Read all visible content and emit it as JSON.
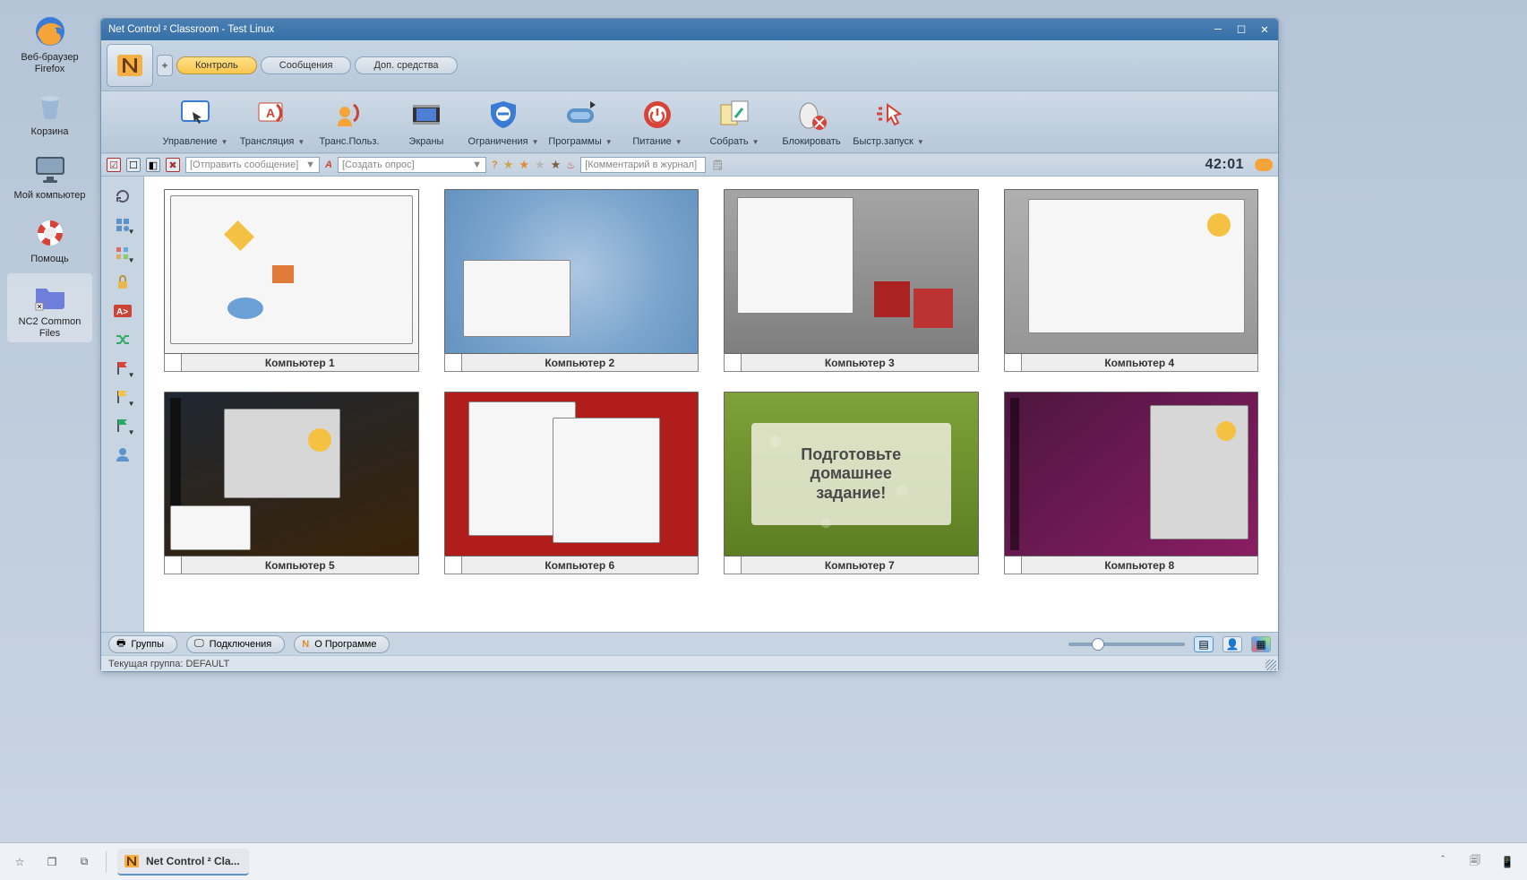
{
  "desktop": {
    "icons": [
      {
        "name": "firefox",
        "label": "Веб-браузер\nFirefox"
      },
      {
        "name": "trash",
        "label": "Корзина"
      },
      {
        "name": "mycomputer",
        "label": "Мой компьютер"
      },
      {
        "name": "help",
        "label": "Помощь"
      },
      {
        "name": "nc2files",
        "label": "NC2 Common\nFiles"
      }
    ]
  },
  "window": {
    "title": "Net Control ² Classroom - Test Linux",
    "ribbon_tabs": [
      "Контроль",
      "Сообщения",
      "Доп. средства"
    ],
    "active_tab": 0,
    "tools": [
      {
        "label": "Управление",
        "drop": true
      },
      {
        "label": "Трансляция",
        "drop": true
      },
      {
        "label": "Транс.Польз.",
        "drop": false
      },
      {
        "label": "Экраны",
        "drop": false
      },
      {
        "label": "Ограничения",
        "drop": true
      },
      {
        "label": "Программы",
        "drop": true
      },
      {
        "label": "Питание",
        "drop": true
      },
      {
        "label": "Собрать",
        "drop": true
      },
      {
        "label": "Блокировать",
        "drop": false
      },
      {
        "label": "Быстр.запуск",
        "drop": true
      }
    ],
    "send_msg_placeholder": "[Отправить сообщение]",
    "create_poll_placeholder": "[Создать опрос]",
    "journal_placeholder": "[Комментарий в журнал]",
    "timer": "42:01",
    "computers": [
      {
        "label": "Компьютер 1",
        "cls": "c1"
      },
      {
        "label": "Компьютер 2",
        "cls": "c2"
      },
      {
        "label": "Компьютер 3",
        "cls": "c3"
      },
      {
        "label": "Компьютер 4",
        "cls": "c4"
      },
      {
        "label": "Компьютер 5",
        "cls": "c5"
      },
      {
        "label": "Компьютер 6",
        "cls": "c6"
      },
      {
        "label": "Компьютер 7",
        "cls": "c7",
        "overlay": "Подготовьте\nдомашнее\nзадание!"
      },
      {
        "label": "Компьютер 8",
        "cls": "c8"
      }
    ],
    "bottom_tabs": [
      "Группы",
      "Подключения",
      "О Программе"
    ],
    "status": "Текущая группа: DEFAULT"
  },
  "taskbar": {
    "app_entry": "Net Control ² Cla..."
  }
}
